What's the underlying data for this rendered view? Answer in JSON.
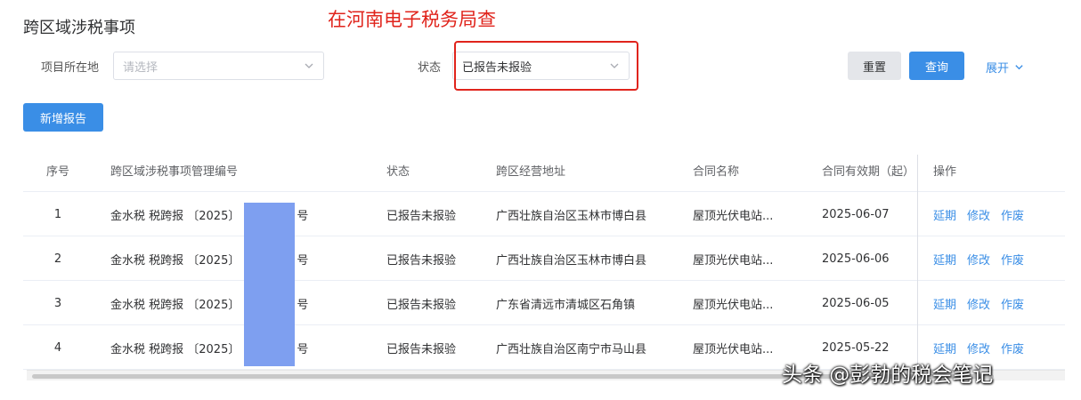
{
  "page": {
    "title": "跨区域涉税事项"
  },
  "annotation": {
    "text": "在河南电子税务局查",
    "color": "#e0241c"
  },
  "filters": {
    "location": {
      "label": "项目所在地",
      "placeholder": "请选择"
    },
    "status": {
      "label": "状态",
      "value": "已报告未报验"
    }
  },
  "buttons": {
    "reset": "重置",
    "query": "查询",
    "expand": "展开",
    "new_report": "新增报告"
  },
  "table": {
    "columns": [
      "序号",
      "跨区域涉税事项管理编号",
      "状态",
      "跨区经营地址",
      "合同名称",
      "合同有效期（起）",
      "操作"
    ],
    "rows": [
      {
        "index": "1",
        "number_prefix": "金水税 税跨报 〔2025〕",
        "number_suffix": "号",
        "status": "已报告未报验",
        "address": "广西壮族自治区玉林市博白县",
        "contract": "屋顶光伏电站...",
        "date": "2025-06-07"
      },
      {
        "index": "2",
        "number_prefix": "金水税 税跨报 〔2025〕",
        "number_suffix": "号",
        "status": "已报告未报验",
        "address": "广西壮族自治区玉林市博白县",
        "contract": "屋顶光伏电站...",
        "date": "2025-06-06"
      },
      {
        "index": "3",
        "number_prefix": "金水税 税跨报 〔2025〕",
        "number_suffix": "号",
        "status": "已报告未报验",
        "address": "广东省清远市清城区石角镇",
        "contract": "屋顶光伏电站...",
        "date": "2025-06-05"
      },
      {
        "index": "4",
        "number_prefix": "金水税 税跨报 〔2025〕",
        "number_suffix": "号",
        "status": "已报告未报验",
        "address": "广西壮族自治区南宁市马山县",
        "contract": "屋顶光伏电站...",
        "date": "2025-05-22"
      }
    ],
    "ops": [
      "延期",
      "修改",
      "作废"
    ]
  },
  "watermark": {
    "text": "头条 @彭勃的税会笔记"
  },
  "colors": {
    "primary": "#3a8ee6",
    "annotation_red": "#e0241c",
    "redaction": "#7e9ff0"
  }
}
